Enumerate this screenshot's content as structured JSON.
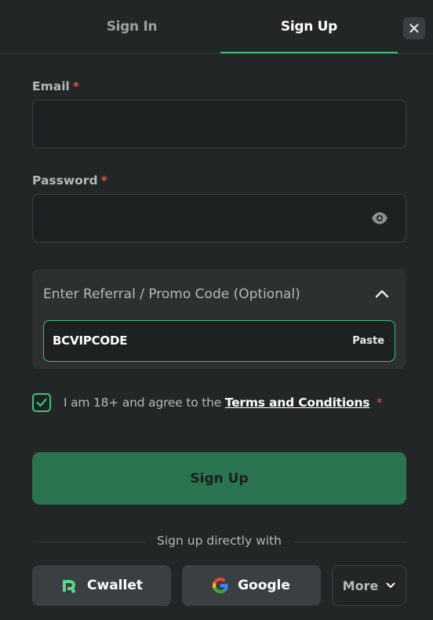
{
  "tabs": {
    "sign_in": "Sign In",
    "sign_up": "Sign Up",
    "active": "Sign Up"
  },
  "form": {
    "email_label": "Email",
    "password_label": "Password",
    "required_mark": "*",
    "email_value": "",
    "password_value": ""
  },
  "promo": {
    "title": "Enter Referral / Promo Code (Optional)",
    "code": "BCVIPCODE",
    "paste_label": "Paste",
    "expanded": true
  },
  "agree": {
    "checked": true,
    "text_before": "I am 18+ and agree to the",
    "terms_link": "Terms and Conditions",
    "required_mark": "*"
  },
  "submit_label": "Sign Up",
  "divider_text": "Sign up directly with",
  "social": {
    "cwallet": "Cwallet",
    "google": "Google",
    "more": "More"
  },
  "icons": {
    "close": "close-icon",
    "eye": "eye-icon",
    "chevron_up": "chevron-up-icon",
    "check": "check-icon",
    "cwallet": "cwallet-icon",
    "google": "google-icon",
    "chevron_down": "chevron-down-icon"
  },
  "colors": {
    "accent": "#3bc17a",
    "button_green": "#2a7450",
    "required": "#ed4d4d",
    "background": "#232626"
  }
}
